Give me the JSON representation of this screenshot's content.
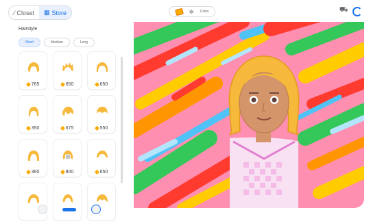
{
  "topbar": {
    "tabs": [
      {
        "label": "Closet",
        "icon": "hanger-icon",
        "active": false
      },
      {
        "label": "Store",
        "icon": "grid-icon",
        "active": true
      }
    ],
    "coins_label": "Coins",
    "actions": [
      "cart-icon",
      "refresh-icon"
    ]
  },
  "sidebar": {
    "title": "Hairstyle",
    "filters": [
      "Short",
      "Medium",
      "Long"
    ],
    "selected_filter": "Short",
    "items": [
      {
        "price": "765"
      },
      {
        "price": "650"
      },
      {
        "price": "650"
      },
      {
        "price": "350"
      },
      {
        "price": "675"
      },
      {
        "price": "550"
      },
      {
        "price": "360"
      },
      {
        "price": "800"
      },
      {
        "price": "650"
      },
      {
        "price": ""
      },
      {
        "price": ""
      },
      {
        "price": ""
      }
    ]
  },
  "colors": {
    "accent": "#1a73e8",
    "hair": "#f6b93b",
    "coin": "#f9ab00",
    "background_stripes": [
      "#ff3b30",
      "#34c759",
      "#ffcc00",
      "#ff8fb1",
      "#4fc3f7",
      "#ff9500",
      "#b3e5fc"
    ]
  },
  "avatar": {
    "hair_color": "#f6b93b",
    "skin_color": "#d4956a",
    "shirt_color": "#f8e1f3"
  }
}
